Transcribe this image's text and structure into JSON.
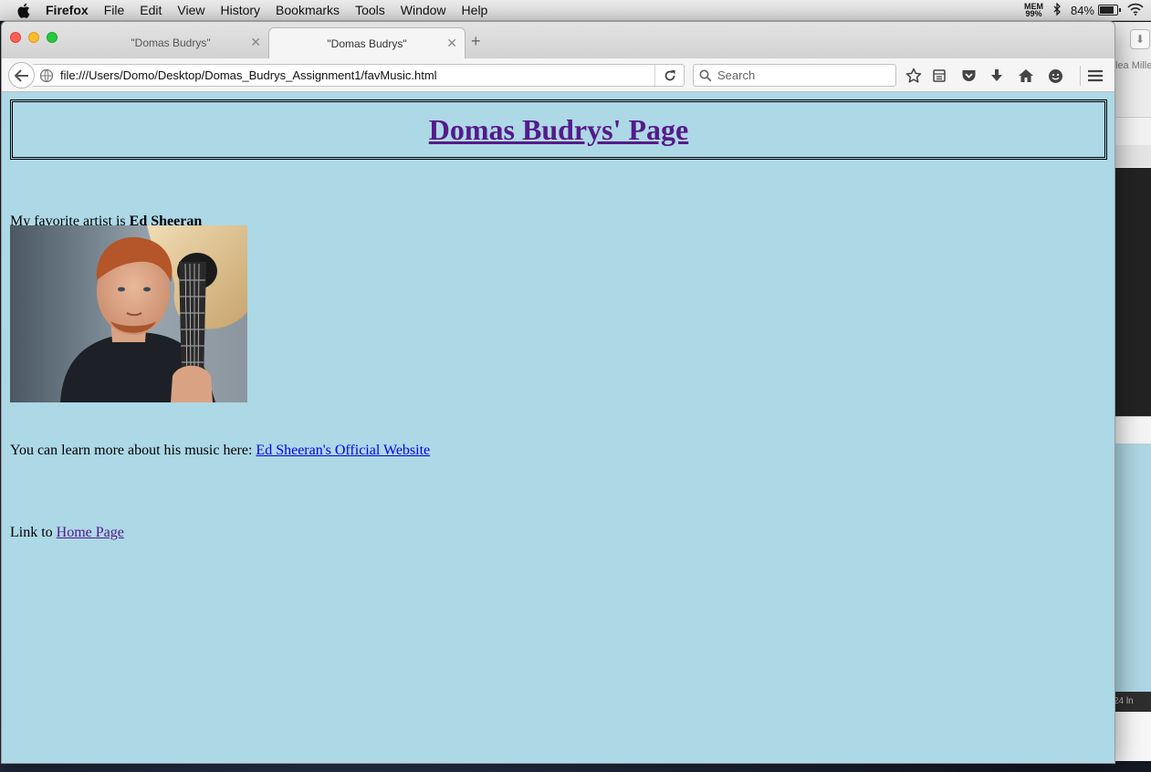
{
  "menubar": {
    "app_name": "Firefox",
    "items": [
      "File",
      "Edit",
      "View",
      "History",
      "Bookmarks",
      "Tools",
      "Window",
      "Help"
    ],
    "mem_label": "MEM",
    "mem_value": "99%",
    "battery_percent": "84%",
    "battery_level": 0.84
  },
  "browser": {
    "tabs": [
      {
        "title": "\"Domas Budrys\"",
        "active": false
      },
      {
        "title": "\"Domas Budrys\"",
        "active": true
      }
    ],
    "url": "file:///Users/Domo/Desktop/Domas_Budrys_Assignment1/favMusic.html",
    "search_placeholder": "Search"
  },
  "page": {
    "heading": "Domas Budrys' Page",
    "favorite_prefix": "My favorite artist is ",
    "artist_name": "Ed Sheeran",
    "learn_more_prefix": "You can learn more about his music here: ",
    "website_link": "Ed Sheeran's Official Website",
    "home_prefix": "Link to ",
    "home_link": "Home Page"
  },
  "background_window": {
    "partial_text": "lea Mille",
    "status_text": "24 ln"
  },
  "colors": {
    "page_background": "#add8e6",
    "visited_link": "#551a8b",
    "link": "#0000ee"
  }
}
